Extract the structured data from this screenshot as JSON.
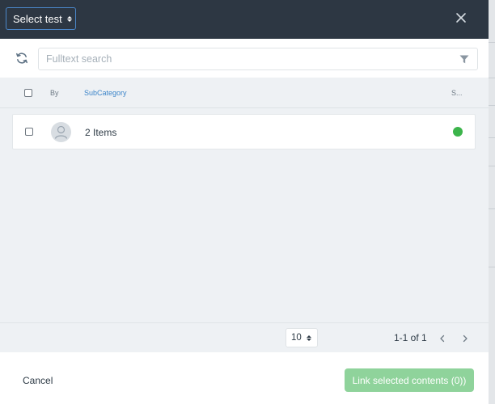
{
  "header": {
    "select_label": "Select test",
    "close_icon": "close-icon"
  },
  "search": {
    "placeholder": "Fulltext search",
    "value": "",
    "refresh_icon": "refresh-icon",
    "filter_icon": "filter-icon"
  },
  "table": {
    "columns": {
      "by": "By",
      "subcategory": "SubCategory",
      "status": "S..."
    },
    "rows": [
      {
        "title": "2 Items",
        "avatar_icon": "user-avatar-icon",
        "status_color": "#3cb44b"
      }
    ]
  },
  "pagination": {
    "page_size": "10",
    "range": "1-1 of 1"
  },
  "footer": {
    "cancel_label": "Cancel",
    "link_label": "Link selected contents (0))"
  },
  "colors": {
    "header_bg": "#2d3743",
    "accent_blue": "#3c85c9",
    "success_green": "#3cb44b",
    "link_button_disabled": "#8fd39b",
    "list_bg": "#eef1f4"
  }
}
